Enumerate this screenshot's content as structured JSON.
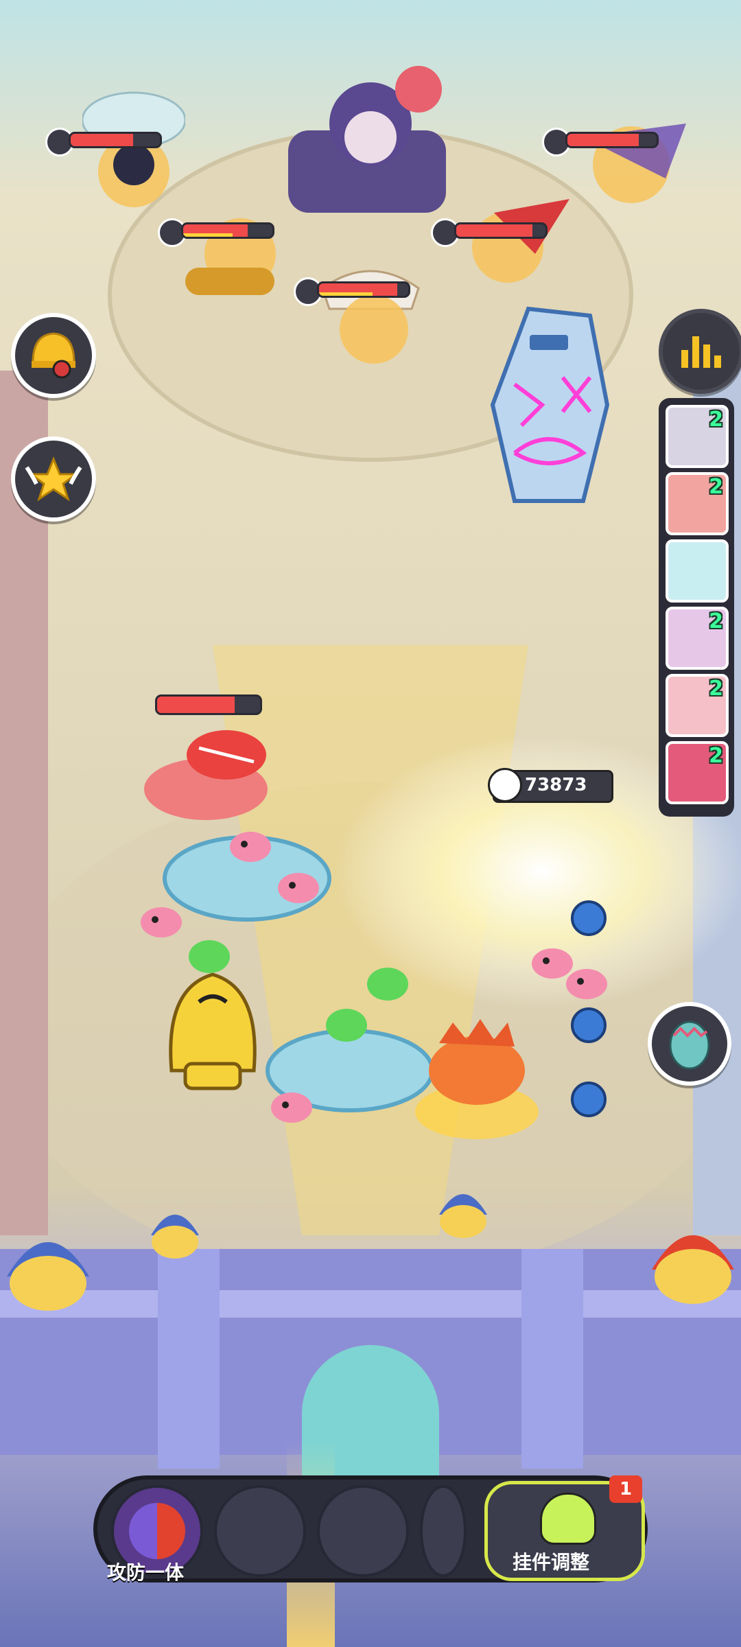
{
  "boss": {
    "hp_number": "73873"
  },
  "right_panel": {
    "heroes": [
      {
        "count": "2"
      },
      {
        "count": "2"
      },
      {
        "count": ""
      },
      {
        "count": "2"
      },
      {
        "count": "2"
      },
      {
        "count": "2"
      }
    ]
  },
  "bottom_bar": {
    "left_skill_label": "攻防一体",
    "plugin_label": "挂件调整",
    "plugin_badge": "1"
  },
  "icons": {
    "left_top": "helmet-icon",
    "left_second": "winged-star-icon",
    "right_top": "stats-bars-icon",
    "right_mid": "egg-icon"
  },
  "colors": {
    "hp_red": "#ef4b4b",
    "hp_yellow": "#ffd33b",
    "hero_count": "#3bff9b",
    "badge": "#e8402c"
  }
}
